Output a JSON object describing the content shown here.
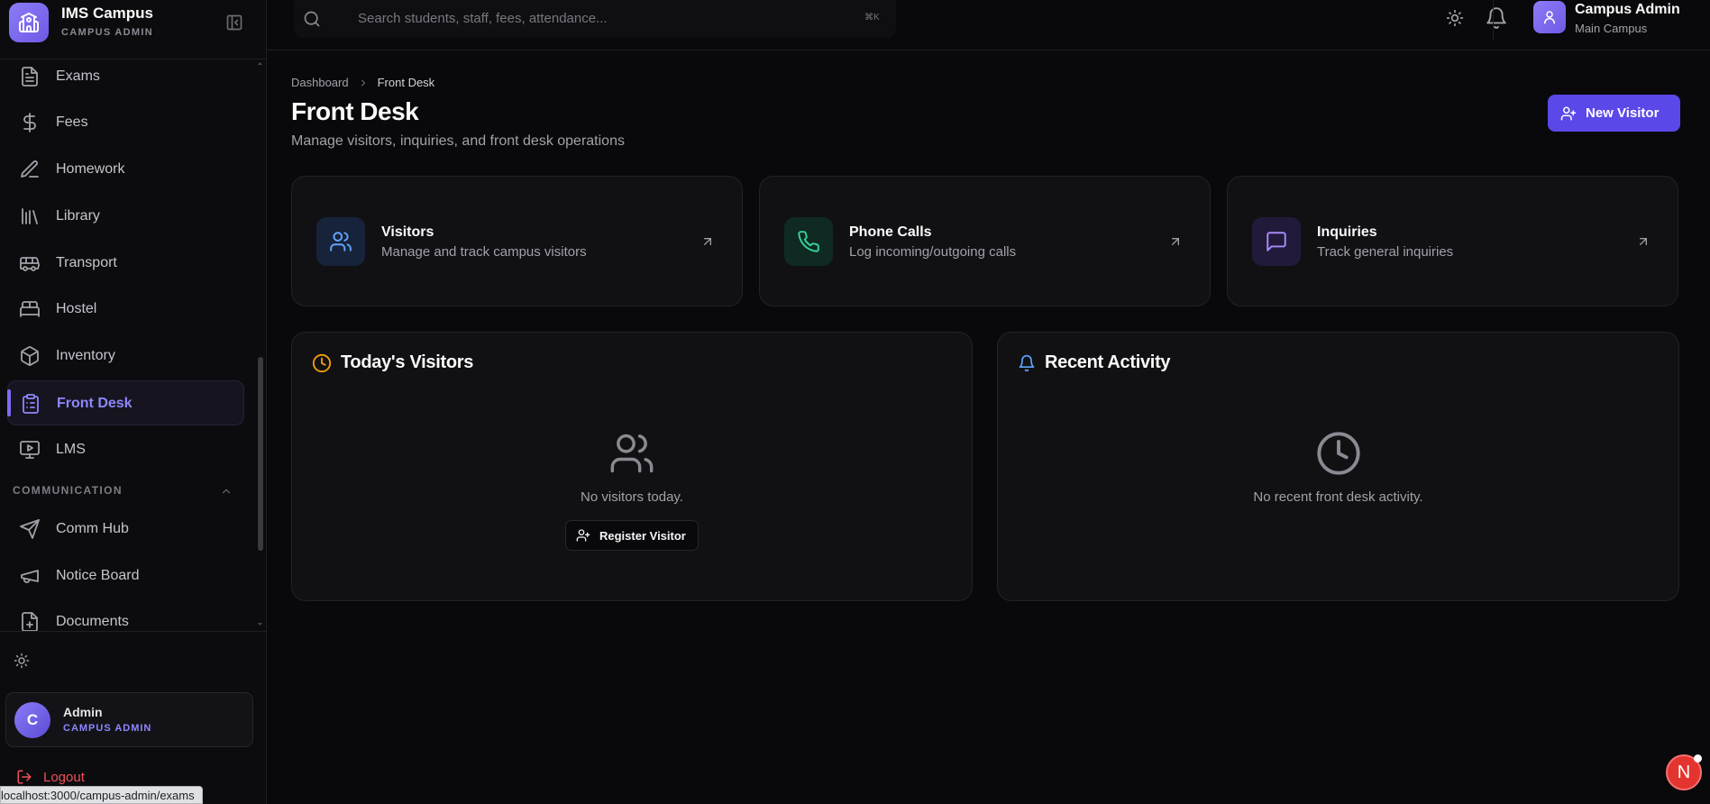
{
  "brand": {
    "name": "IMS Campus",
    "role": "CAMPUS ADMIN"
  },
  "sidebar": {
    "items": [
      {
        "label": "Exams",
        "icon": "document-icon"
      },
      {
        "label": "Fees",
        "icon": "dollar-icon"
      },
      {
        "label": "Homework",
        "icon": "pencil-icon"
      },
      {
        "label": "Library",
        "icon": "library-icon"
      },
      {
        "label": "Transport",
        "icon": "bus-icon"
      },
      {
        "label": "Hostel",
        "icon": "bed-icon"
      },
      {
        "label": "Inventory",
        "icon": "box-icon"
      },
      {
        "label": "Front Desk",
        "icon": "clipboard-icon",
        "active": true
      },
      {
        "label": "LMS",
        "icon": "monitor-play-icon"
      }
    ],
    "section": "COMMUNICATION",
    "comm_items": [
      {
        "label": "Comm Hub",
        "icon": "send-icon"
      },
      {
        "label": "Notice Board",
        "icon": "megaphone-icon"
      },
      {
        "label": "Documents",
        "icon": "file-plus-icon"
      }
    ],
    "user": {
      "initial": "C",
      "name": "Admin",
      "role": "CAMPUS ADMIN"
    },
    "logout_label": "Logout"
  },
  "status_url": "localhost:3000/campus-admin/exams",
  "topbar": {
    "search_placeholder": "Search students, staff, fees, attendance...",
    "search_shortcut": "⌘K",
    "profile_name": "Campus Admin",
    "profile_campus": "Main Campus"
  },
  "breadcrumb": {
    "root": "Dashboard",
    "current": "Front Desk"
  },
  "page": {
    "title": "Front Desk",
    "subtitle": "Manage visitors, inquiries, and front desk operations",
    "new_visitor_label": "New Visitor"
  },
  "quick_cards": [
    {
      "title": "Visitors",
      "desc": "Manage and track campus visitors",
      "icon": "users-icon",
      "color": "#60a5fa",
      "bg": "#17233a"
    },
    {
      "title": "Phone Calls",
      "desc": "Log incoming/outgoing calls",
      "icon": "phone-icon",
      "color": "#34d399",
      "bg": "#0f2a22"
    },
    {
      "title": "Inquiries",
      "desc": "Track general inquiries",
      "icon": "message-square-icon",
      "color": "#a78bfa",
      "bg": "#221a3a"
    }
  ],
  "todays_visitors": {
    "title": "Today's Visitors",
    "empty_text": "No visitors today.",
    "register_label": "Register Visitor"
  },
  "recent_activity": {
    "title": "Recent Activity",
    "empty_text": "No recent front desk activity."
  },
  "badge_letter": "N",
  "colors": {
    "accent": "#5b48e8",
    "accent_text": "#8f86ff",
    "danger": "#f0505a",
    "warning": "#f59e0b",
    "info": "#60a5fa"
  }
}
